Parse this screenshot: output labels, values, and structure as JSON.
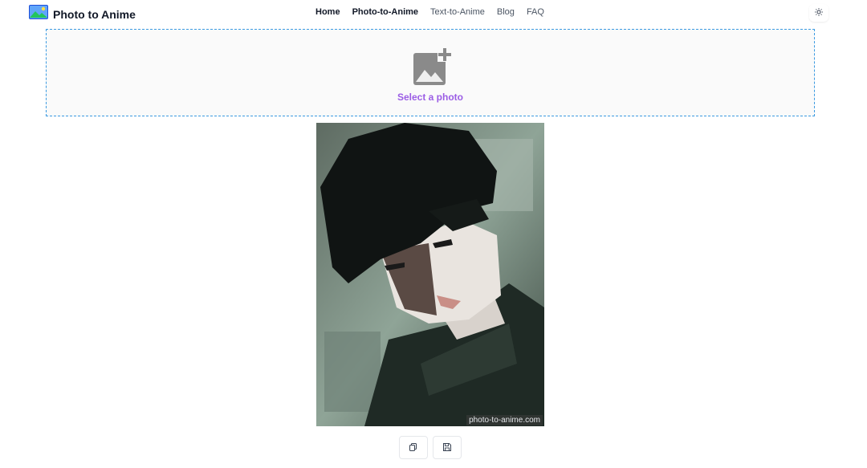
{
  "brand": {
    "name": "Photo to Anime",
    "logo_icon": "image-landscape-icon",
    "accent": "#a855f7"
  },
  "nav": {
    "items": [
      {
        "label": "Home"
      },
      {
        "label": "Photo-to-Anime"
      },
      {
        "label": "Text-to-Anime"
      },
      {
        "label": "Blog"
      },
      {
        "label": "FAQ"
      }
    ]
  },
  "theme_toggle": {
    "icon": "sun-icon"
  },
  "upload": {
    "label": "Select a photo",
    "icon": "add-photo-icon",
    "border_color": "#3b9ae1"
  },
  "result": {
    "watermark": "photo-to-anime.com",
    "image": "anime-style portrait"
  },
  "actions": {
    "copy_icon": "copy-icon",
    "save_icon": "save-icon"
  }
}
